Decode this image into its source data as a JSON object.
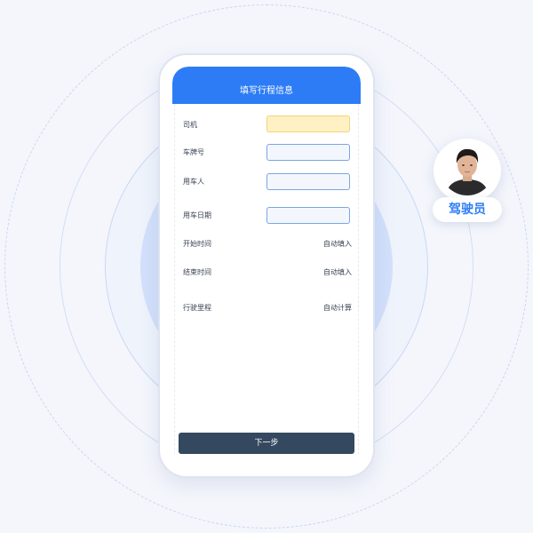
{
  "header": {
    "title": "填写行程信息"
  },
  "form": {
    "driver_label": "司机",
    "plate_label": "车牌号",
    "user_label": "用车人",
    "date_label": "用车日期",
    "start_time_label": "开始时间",
    "start_time_value": "自动填入",
    "end_time_label": "结束时间",
    "end_time_value": "自动填入",
    "mileage_label": "行驶里程",
    "mileage_value": "自动计算"
  },
  "actions": {
    "next_label": "下一步"
  },
  "role": {
    "badge_label": "驾驶员"
  },
  "colors": {
    "accent": "#2d7cf6",
    "button": "#34495f",
    "active_field": "#fff1c4",
    "field_border": "#7aa6e0"
  }
}
